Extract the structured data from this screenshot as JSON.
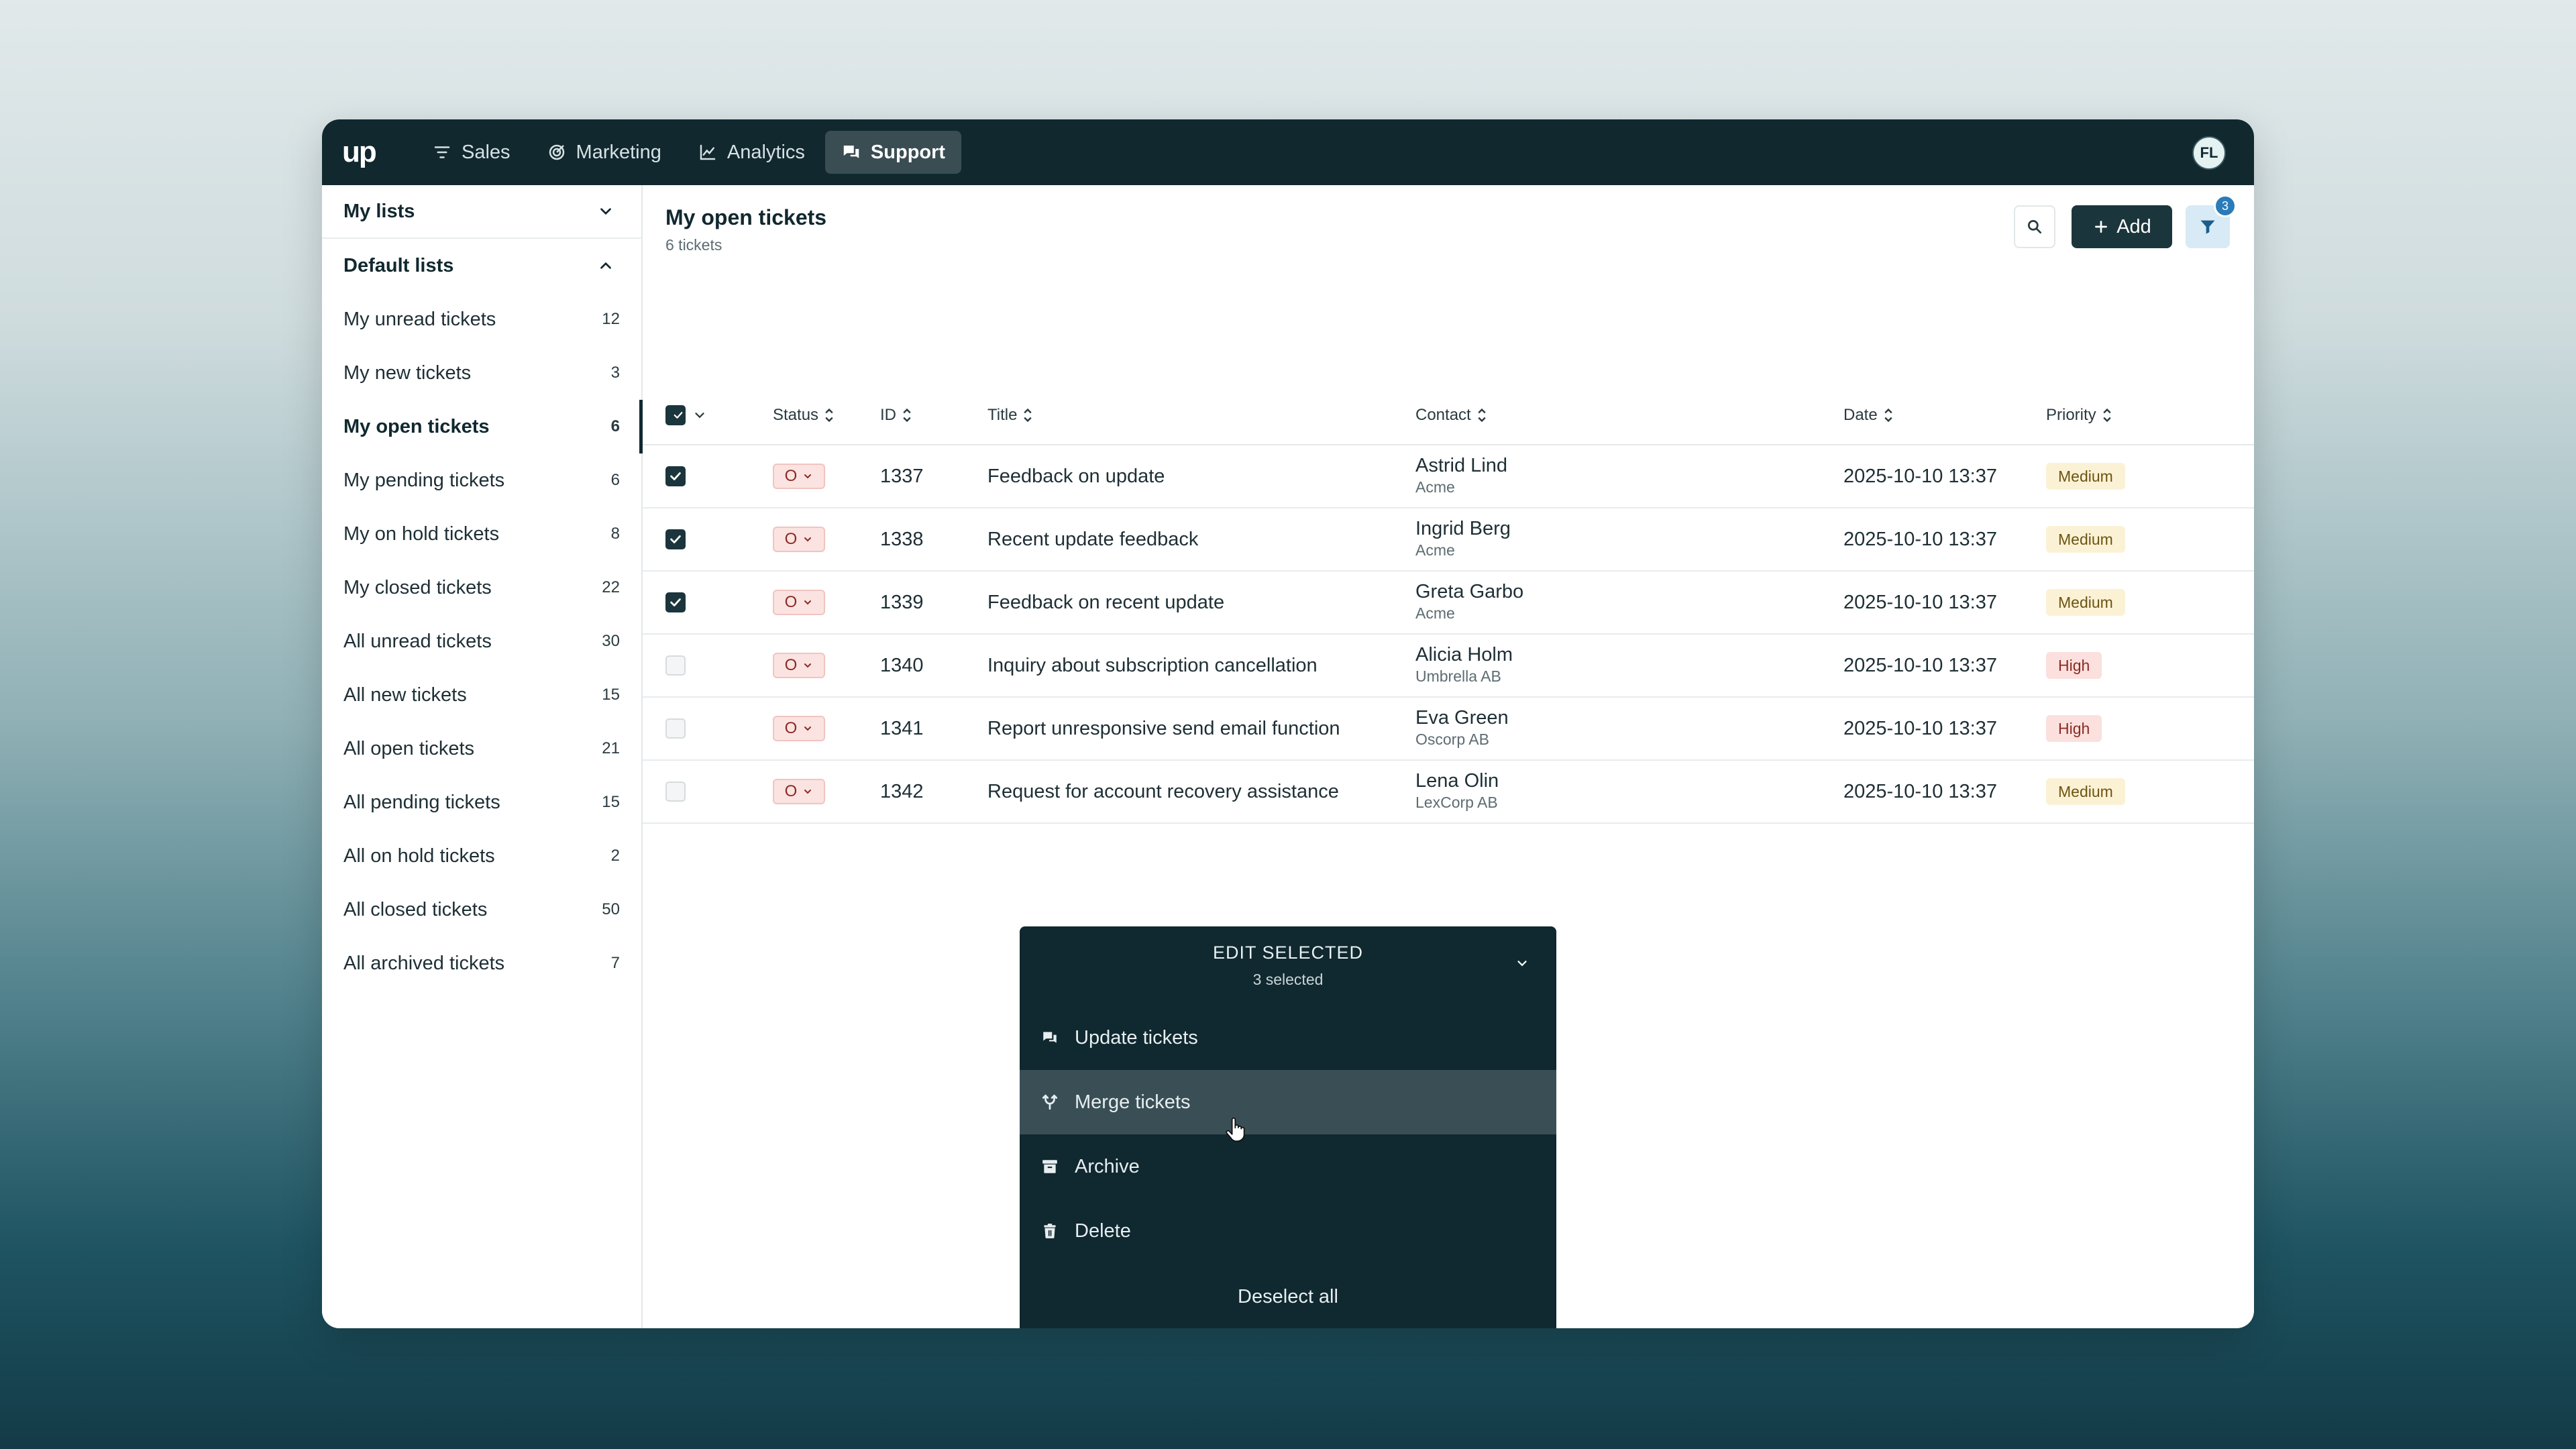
{
  "nav": {
    "logo": "up",
    "items": [
      {
        "label": "Sales",
        "icon": "filter-lines-icon",
        "active": false
      },
      {
        "label": "Marketing",
        "icon": "target-icon",
        "active": false
      },
      {
        "label": "Analytics",
        "icon": "chart-line-icon",
        "active": false
      },
      {
        "label": "Support",
        "icon": "chat-bubbles-icon",
        "active": true
      }
    ],
    "avatar_initials": "FL"
  },
  "sidebar": {
    "my_lists_label": "My lists",
    "default_lists_label": "Default lists",
    "items": [
      {
        "label": "My unread tickets",
        "count": "12"
      },
      {
        "label": "My new tickets",
        "count": "3"
      },
      {
        "label": "My open tickets",
        "count": "6",
        "active": true
      },
      {
        "label": "My pending tickets",
        "count": "6"
      },
      {
        "label": "My on hold tickets",
        "count": "8"
      },
      {
        "label": "My closed tickets",
        "count": "22"
      },
      {
        "label": "All unread tickets",
        "count": "30"
      },
      {
        "label": "All new tickets",
        "count": "15"
      },
      {
        "label": "All open tickets",
        "count": "21"
      },
      {
        "label": "All pending tickets",
        "count": "15"
      },
      {
        "label": "All on hold tickets",
        "count": "2"
      },
      {
        "label": "All closed tickets",
        "count": "50"
      },
      {
        "label": "All archived tickets",
        "count": "7"
      }
    ]
  },
  "main": {
    "title": "My open tickets",
    "subtitle": "6 tickets",
    "add_label": "Add",
    "filter_count": "3"
  },
  "table": {
    "columns": {
      "status": "Status",
      "id": "ID",
      "title": "Title",
      "contact": "Contact",
      "date": "Date",
      "priority": "Priority"
    },
    "rows": [
      {
        "checked": true,
        "status": "O",
        "id": "1337",
        "title": "Feedback on update",
        "contact": "Astrid Lind",
        "company": "Acme",
        "date": "2025-10-10 13:37",
        "priority": "Medium"
      },
      {
        "checked": true,
        "status": "O",
        "id": "1338",
        "title": "Recent update feedback",
        "contact": "Ingrid Berg",
        "company": "Acme",
        "date": "2025-10-10 13:37",
        "priority": "Medium"
      },
      {
        "checked": true,
        "status": "O",
        "id": "1339",
        "title": "Feedback on recent update",
        "contact": "Greta Garbo",
        "company": "Acme",
        "date": "2025-10-10 13:37",
        "priority": "Medium"
      },
      {
        "checked": false,
        "status": "O",
        "id": "1340",
        "title": "Inquiry about subscription cancellation",
        "contact": "Alicia Holm",
        "company": "Umbrella AB",
        "date": "2025-10-10 13:37",
        "priority": "High"
      },
      {
        "checked": false,
        "status": "O",
        "id": "1341",
        "title": "Report unresponsive send email function",
        "contact": "Eva Green",
        "company": "Oscorp AB",
        "date": "2025-10-10 13:37",
        "priority": "High"
      },
      {
        "checked": false,
        "status": "O",
        "id": "1342",
        "title": "Request for account recovery assistance",
        "contact": "Lena Olin",
        "company": "LexCorp AB",
        "date": "2025-10-10 13:37",
        "priority": "Medium"
      }
    ]
  },
  "edit_panel": {
    "title": "EDIT SELECTED",
    "subtitle": "3 selected",
    "items": [
      {
        "label": "Update tickets",
        "icon": "chat-bubbles-icon"
      },
      {
        "label": "Merge tickets",
        "icon": "merge-icon",
        "hover": true
      },
      {
        "label": "Archive",
        "icon": "archive-icon"
      },
      {
        "label": "Delete",
        "icon": "trash-icon"
      }
    ],
    "deselect_label": "Deselect all"
  },
  "colors": {
    "nav_bg": "#11282f",
    "panel_bg": "#10282f",
    "medium_badge": "#fbf2d6",
    "high_badge": "#fbe0de",
    "filter_badge": "#2b7bb9"
  }
}
